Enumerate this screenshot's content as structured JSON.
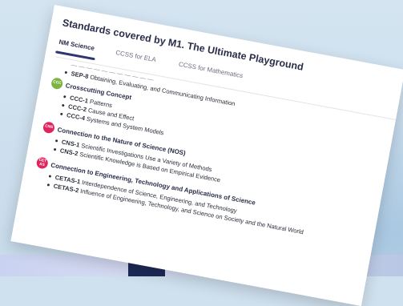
{
  "card": {
    "title": "Standards covered by M1. The Ultimate Playground",
    "tabs": [
      {
        "label": "NM Science",
        "active": true
      },
      {
        "label": "CCSS for ELA",
        "active": false
      },
      {
        "label": "CCSS for Mathematics",
        "active": false
      }
    ]
  },
  "sep": {
    "clipped_text": "— — — — — — — — — — —",
    "code": "SEP-8",
    "text": "Obtaining, Evaluating, and Communicating Information"
  },
  "ccc": {
    "badge": "CCC",
    "badge_color": "#7cb342",
    "heading": "Crosscutting Concept",
    "items": [
      {
        "code": "CCC-1",
        "text": "Patterns"
      },
      {
        "code": "CCC-2",
        "text": "Cause and Effect"
      },
      {
        "code": "CCC-4",
        "text": "Systems and System Models"
      }
    ]
  },
  "cns": {
    "badge": "CNS",
    "badge_color": "#e0245e",
    "heading": "Connection to the Nature of Science (NOS)",
    "items": [
      {
        "code": "CNS-1",
        "text": "Scientific Investigations Use a Variety of Methods"
      },
      {
        "code": "CNS-2",
        "text": "Scientific Knowledge is Based on Empirical Evidence"
      }
    ]
  },
  "cetas": {
    "badge_line1": "CET",
    "badge_line2": "AS",
    "badge_color": "#e0245e",
    "heading": "Connection to Engineering, Technology and Applications of Science",
    "items": [
      {
        "code": "CETAS-1",
        "text": "Interdependence of Science, Engineering, and Technology"
      },
      {
        "code": "CETAS-2",
        "text": "Influence of Engineering, Technology, and Science on Society and the Natural World"
      }
    ]
  }
}
